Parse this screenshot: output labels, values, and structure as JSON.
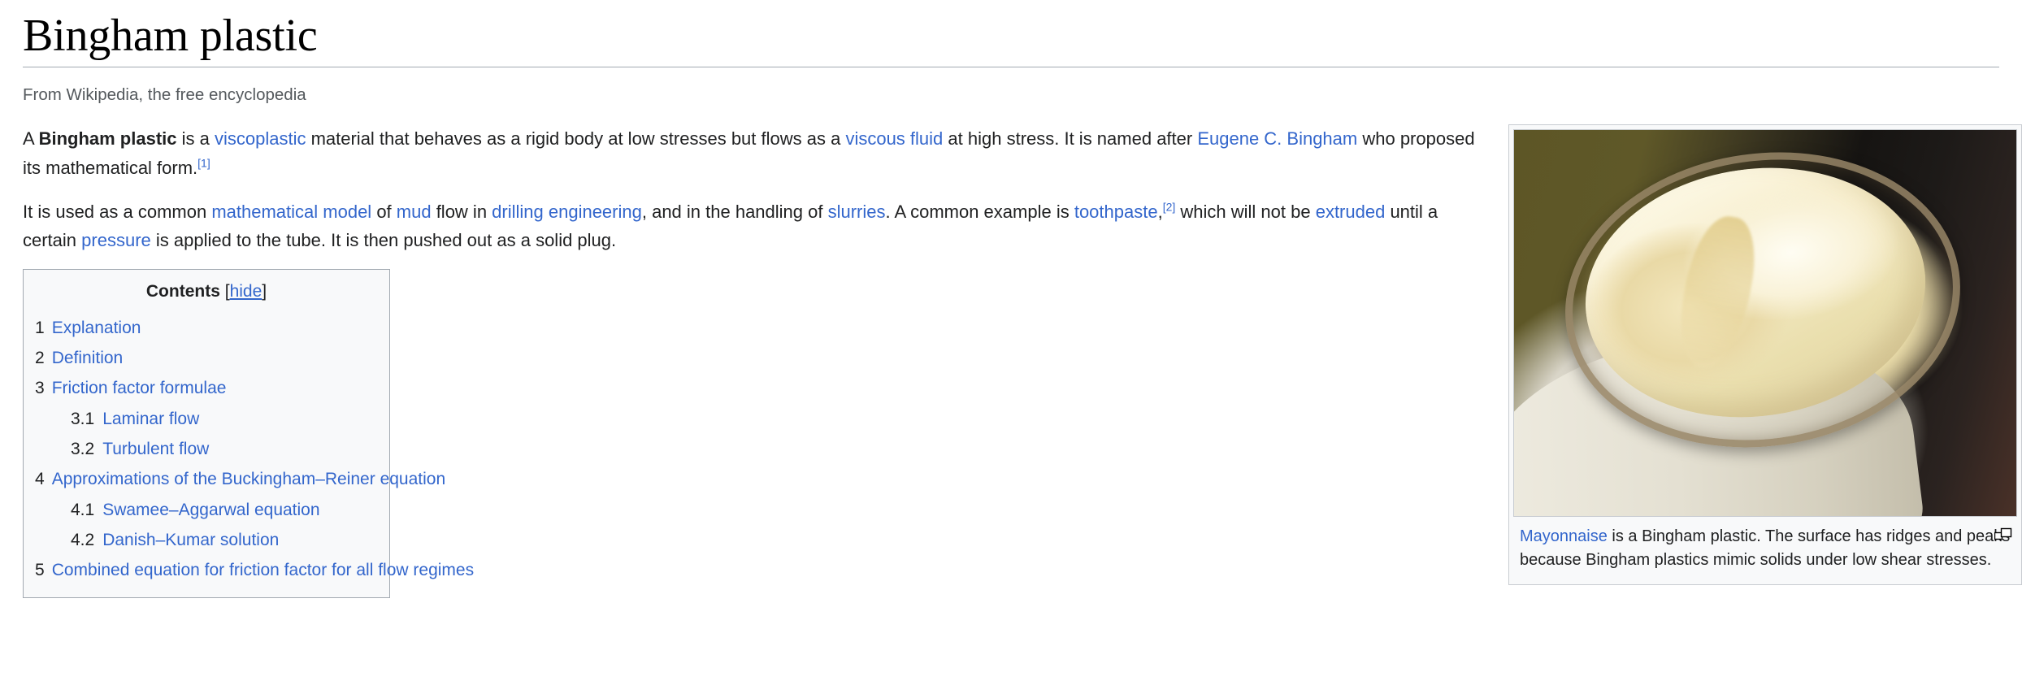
{
  "article": {
    "title": "Bingham plastic",
    "tagline": "From Wikipedia, the free encyclopedia"
  },
  "paragraphs": {
    "p1": {
      "t1": "A ",
      "bold": "Bingham plastic",
      "t2": " is a ",
      "link1": "viscoplastic",
      "t3": " material that behaves as a rigid body at low stresses but flows as a ",
      "link2": "viscous fluid",
      "t4": " at high stress. It is named after ",
      "link3": "Eugene C. Bingham",
      "t5": " who proposed its mathematical form.",
      "ref": "[1]"
    },
    "p2": {
      "t1": "It is used as a common ",
      "link1": "mathematical model",
      "t2": " of ",
      "link2": "mud",
      "t3": " flow in ",
      "link3": "drilling engineering",
      "t4": ", and in the handling of ",
      "link4": "slurries",
      "t5": ". A common example is ",
      "link5": "toothpaste",
      "t6": ",",
      "ref": "[2]",
      "t7": " which will not be ",
      "link6": "extruded",
      "t8": " until a certain ",
      "link7": "pressure",
      "t9": " is applied to the tube. It is then pushed out as a solid plug."
    }
  },
  "toc": {
    "heading": "Contents",
    "bracket_open": "[",
    "hide_label": "hide",
    "bracket_close": "]",
    "items": [
      {
        "num": "1",
        "label": "Explanation",
        "level": 1
      },
      {
        "num": "2",
        "label": "Definition",
        "level": 1
      },
      {
        "num": "3",
        "label": "Friction factor formulae",
        "level": 1
      },
      {
        "num": "3.1",
        "label": "Laminar flow",
        "level": 2
      },
      {
        "num": "3.2",
        "label": "Turbulent flow",
        "level": 2
      },
      {
        "num": "4",
        "label": "Approximations of the Buckingham–Reiner equation",
        "level": 1
      },
      {
        "num": "4.1",
        "label": "Swamee–Aggarwal equation",
        "level": 2
      },
      {
        "num": "4.2",
        "label": "Danish–Kumar solution",
        "level": 2
      },
      {
        "num": "5",
        "label": "Combined equation for friction factor for all flow regimes",
        "level": 1
      }
    ]
  },
  "thumbnail": {
    "alt": "Open jar of mayonnaise showing ridges and peaks on the surface",
    "caption_link": "Mayonnaise",
    "caption_text": " is a Bingham plastic. The surface has ridges and peaks because Bingham plastics mimic solids under low shear stresses.",
    "enlarge_icon": "magnify-icon"
  },
  "colors": {
    "link": "#3366cc",
    "text": "#202122",
    "tagline": "#54595d",
    "rule": "#a2a9b1",
    "toc_bg": "#f8f9fa",
    "toc_border": "#a2a9b1",
    "thumb_border": "#c8ccd1"
  }
}
